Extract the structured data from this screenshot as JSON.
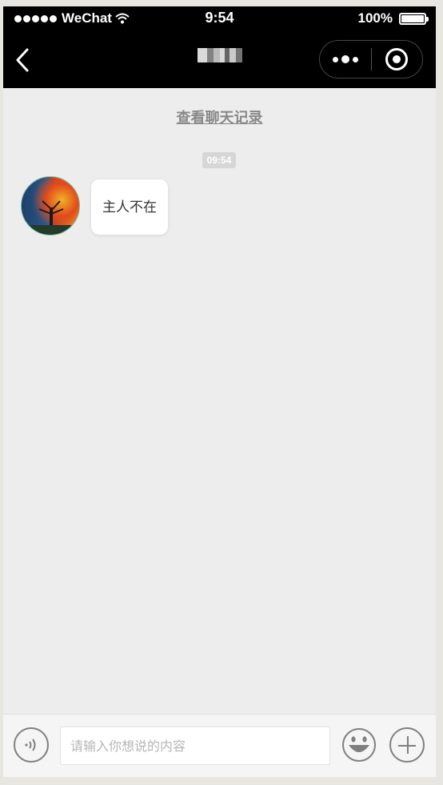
{
  "status_bar": {
    "carrier": "WeChat",
    "time": "9:54",
    "battery_text": "100%",
    "battery_level": 1.0,
    "signal_icon": "signal-dots-icon",
    "wifi_icon": "wifi-icon"
  },
  "nav": {
    "back_icon": "chevron-left-icon",
    "more_icon": "more-dots-icon",
    "close_icon": "target-close-icon"
  },
  "chat": {
    "history_link": "查看聊天记录",
    "timestamp": "09:54",
    "message": "主人不在"
  },
  "input_bar": {
    "placeholder": "请输入你想说的内容",
    "voice_icon": "voice-icon",
    "emoji_icon": "emoji-icon",
    "plus_icon": "plus-icon"
  },
  "colors": {
    "nav_background": "#000000",
    "chat_background": "#ededed",
    "bubble": "#ffffff"
  }
}
